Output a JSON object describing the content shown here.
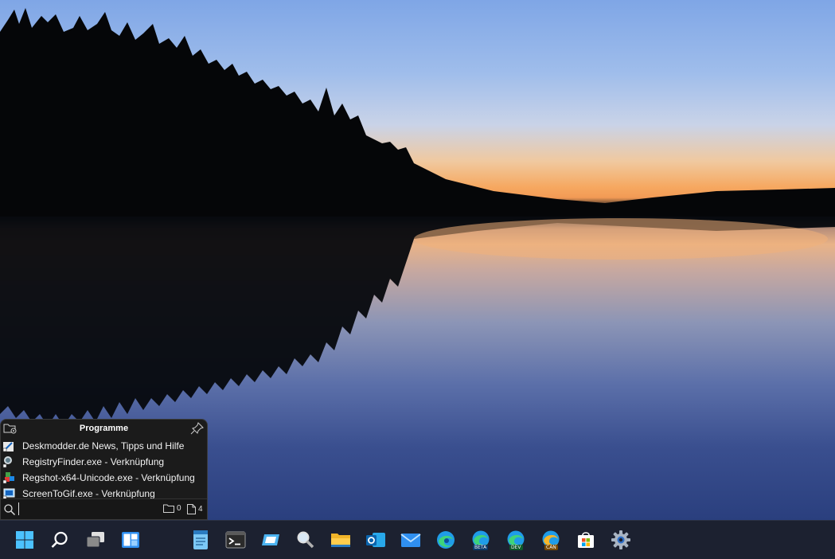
{
  "wallpaper": {
    "sky_top": "#7fa6e6",
    "horizon_glow": "#f29a55",
    "water_bottom": "#2a3f7e"
  },
  "popup": {
    "title": "Programme",
    "header_left_icon": "folder-settings-icon",
    "header_right_icon": "pin-icon",
    "items": [
      {
        "label": "Deskmodder.de   News, Tipps und Hilfe",
        "icon": "web-shortcut-icon"
      },
      {
        "label": "RegistryFinder.exe - Verknüpfung",
        "icon": "registry-finder-icon"
      },
      {
        "label": "Regshot-x64-Unicode.exe - Verknüpfung",
        "icon": "regshot-icon"
      },
      {
        "label": "ScreenToGif.exe - Verknüpfung",
        "icon": "screentogif-icon"
      }
    ],
    "search": {
      "value": "",
      "placeholder": ""
    },
    "folder_count": "0",
    "file_count": "4"
  },
  "taskbar": {
    "background": "#1c2130",
    "items": [
      {
        "name": "start-button",
        "icon": "windows-logo-icon"
      },
      {
        "name": "search-button",
        "icon": "search-icon"
      },
      {
        "name": "task-view-button",
        "icon": "task-view-icon"
      },
      {
        "name": "widgets-button",
        "icon": "widgets-icon"
      },
      {
        "name": "notepad-button",
        "icon": "notepad-icon"
      },
      {
        "name": "terminal-button",
        "icon": "terminal-icon"
      },
      {
        "name": "app-button",
        "icon": "app-window-icon"
      },
      {
        "name": "magnifier-search-button",
        "icon": "magnifier-icon"
      },
      {
        "name": "file-explorer-button",
        "icon": "folder-icon"
      },
      {
        "name": "outlook-button",
        "icon": "outlook-icon"
      },
      {
        "name": "mail-button",
        "icon": "mail-icon"
      },
      {
        "name": "edge-button",
        "icon": "edge-icon"
      },
      {
        "name": "edge-beta-button",
        "icon": "edge-beta-icon",
        "badge": "BETA"
      },
      {
        "name": "edge-dev-button",
        "icon": "edge-dev-icon",
        "badge": "DEV"
      },
      {
        "name": "edge-canary-button",
        "icon": "edge-canary-icon",
        "badge": "CAN"
      },
      {
        "name": "store-button",
        "icon": "store-icon"
      },
      {
        "name": "settings-button",
        "icon": "gear-icon"
      }
    ]
  }
}
